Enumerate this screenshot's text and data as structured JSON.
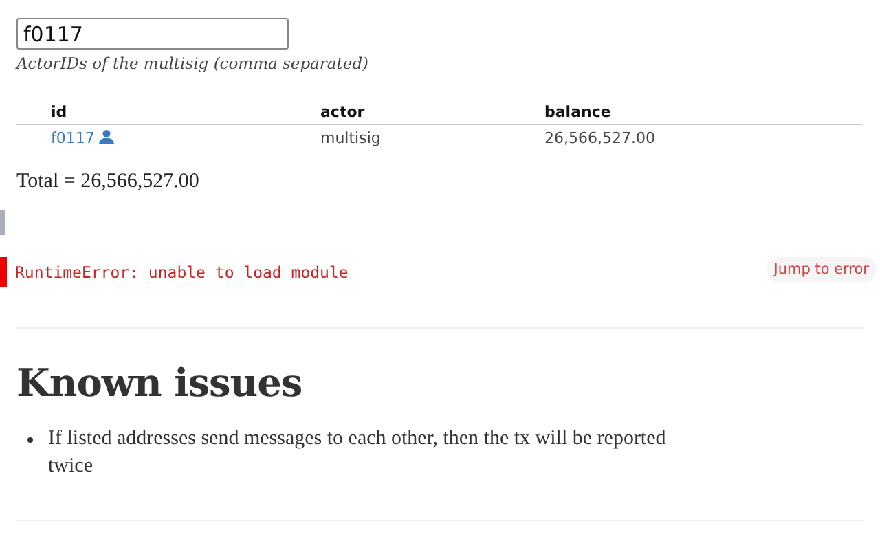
{
  "input": {
    "value": "f0117",
    "caption": "ActorIDs of the multisig (comma separated)"
  },
  "table": {
    "columns": [
      "id",
      "actor",
      "balance"
    ],
    "rows": [
      {
        "id": "f0117",
        "actor": "multisig",
        "balance": "26,566,527.00"
      }
    ]
  },
  "total": "Total = 26,566,527.00",
  "error": {
    "message": "RuntimeError: unable to load module",
    "button": "Jump to error"
  },
  "known_issues": {
    "heading": "Known issues",
    "items": [
      "If listed addresses send messages to each other, then the tx will be reported twice"
    ]
  }
}
